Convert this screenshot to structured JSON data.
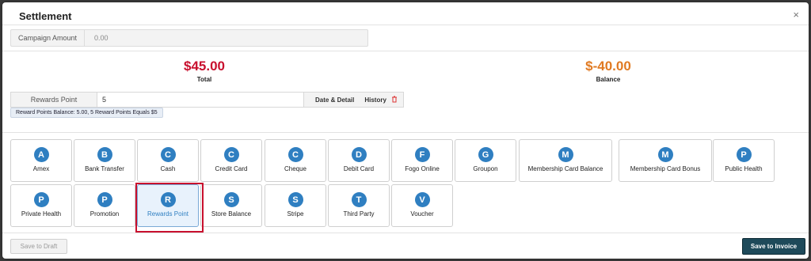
{
  "modal": {
    "title": "Settlement",
    "close": "×"
  },
  "campaign": {
    "label": "Campaign Amount",
    "value": "0.00"
  },
  "total": {
    "amount": "$45.00",
    "label": "Total",
    "color": "#c8102e"
  },
  "balance": {
    "amount": "$-40.00",
    "label": "Balance",
    "color": "#e07a22"
  },
  "rewards": {
    "label": "Rewards Point",
    "value": "5",
    "date_detail": "Date & Detail",
    "history": "History",
    "note": "Reward Points Balance: 5.00, 5 Reward Points Equals $5"
  },
  "methods": [
    {
      "letter": "A",
      "name": "Amex"
    },
    {
      "letter": "B",
      "name": "Bank Transfer"
    },
    {
      "letter": "C",
      "name": "Cash"
    },
    {
      "letter": "C",
      "name": "Credit Card"
    },
    {
      "letter": "C",
      "name": "Cheque"
    },
    {
      "letter": "D",
      "name": "Debit Card"
    },
    {
      "letter": "F",
      "name": "Fogo Online"
    },
    {
      "letter": "G",
      "name": "Groupon"
    },
    {
      "letter": "M",
      "name": "Membership Card Balance"
    },
    {
      "letter": "M",
      "name": "Membership Card Bonus"
    },
    {
      "letter": "P",
      "name": "Public Health"
    },
    {
      "letter": "P",
      "name": "Private Health"
    },
    {
      "letter": "P",
      "name": "Promotion"
    },
    {
      "letter": "R",
      "name": "Rewards Point",
      "selected": true
    },
    {
      "letter": "S",
      "name": "Store Balance"
    },
    {
      "letter": "S",
      "name": "Stripe"
    },
    {
      "letter": "T",
      "name": "Third Party"
    },
    {
      "letter": "V",
      "name": "Voucher"
    }
  ],
  "footer": {
    "draft": "Save to Draft",
    "save": "Save to Invoice"
  }
}
